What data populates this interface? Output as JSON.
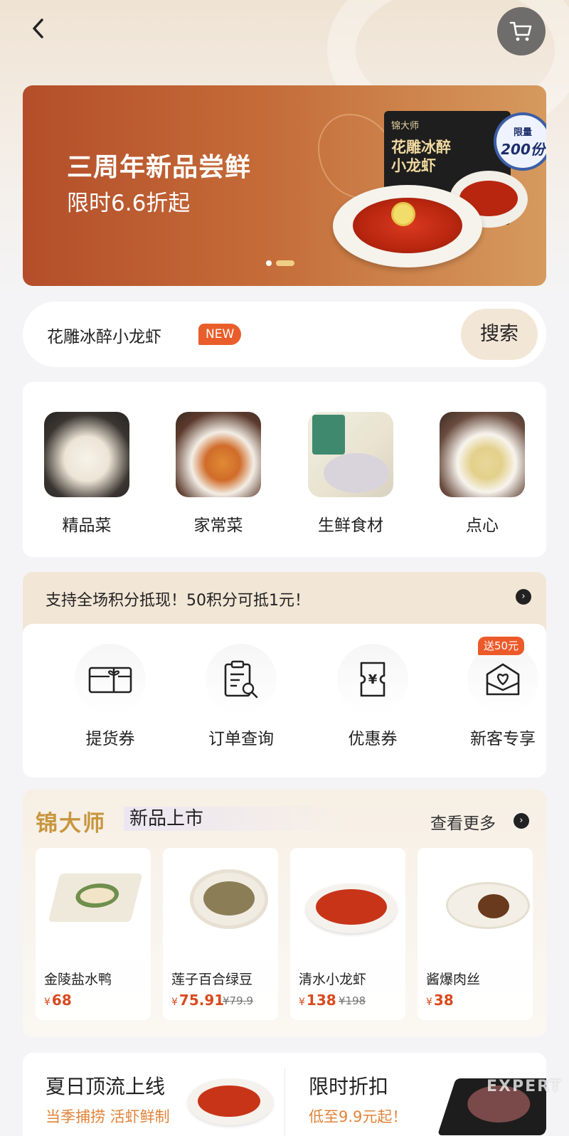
{
  "header": {
    "back_icon": "chevron-left-icon",
    "cart_icon": "cart-icon"
  },
  "banner": {
    "title": "三周年新品尝鲜",
    "subtitle": "限时6.6折起",
    "box_brand": "锦大师",
    "box_name": "花雕冰醉小龙虾",
    "stamp_top": "限量",
    "stamp_main": "200份",
    "slides_total": 2,
    "active_slide": 2
  },
  "search": {
    "keyword": "花雕冰醉小龙虾",
    "badge": "NEW",
    "button": "搜索"
  },
  "categories": [
    {
      "label": "精品菜"
    },
    {
      "label": "家常菜"
    },
    {
      "label": "生鲜食材"
    },
    {
      "label": "点心"
    }
  ],
  "points": {
    "text": "支持全场积分抵现！50积分可抵1元！",
    "arrow_icon": "chevron-right-icon"
  },
  "services": {
    "items": [
      {
        "label": "提货券",
        "icon": "gift-card-icon"
      },
      {
        "label": "订单查询",
        "icon": "order-search-icon"
      },
      {
        "label": "优惠券",
        "icon": "coupon-icon"
      },
      {
        "label": "新客专享",
        "icon": "heart-envelope-icon"
      }
    ],
    "newcomer_badge": "送50元"
  },
  "new_products": {
    "brand": "锦大师",
    "title": "新品上市",
    "more": "查看更多",
    "items": [
      {
        "name": "金陵盐水鸭",
        "price": "68",
        "original_price": ""
      },
      {
        "name": "莲子百合绿豆",
        "price": "75.91",
        "original_price": "¥79.9"
      },
      {
        "name": "清水小龙虾",
        "price": "138",
        "original_price": "¥198"
      },
      {
        "name": "酱爆肉丝",
        "price": "38",
        "original_price": ""
      }
    ],
    "currency": "¥"
  },
  "promos": {
    "left_title": "夏日顶流上线",
    "left_sub": "当季捕捞 活虾鲜制",
    "right_title": "限时折扣",
    "right_sub": "低至9.9元起！"
  },
  "watermark": "EXPERT"
}
